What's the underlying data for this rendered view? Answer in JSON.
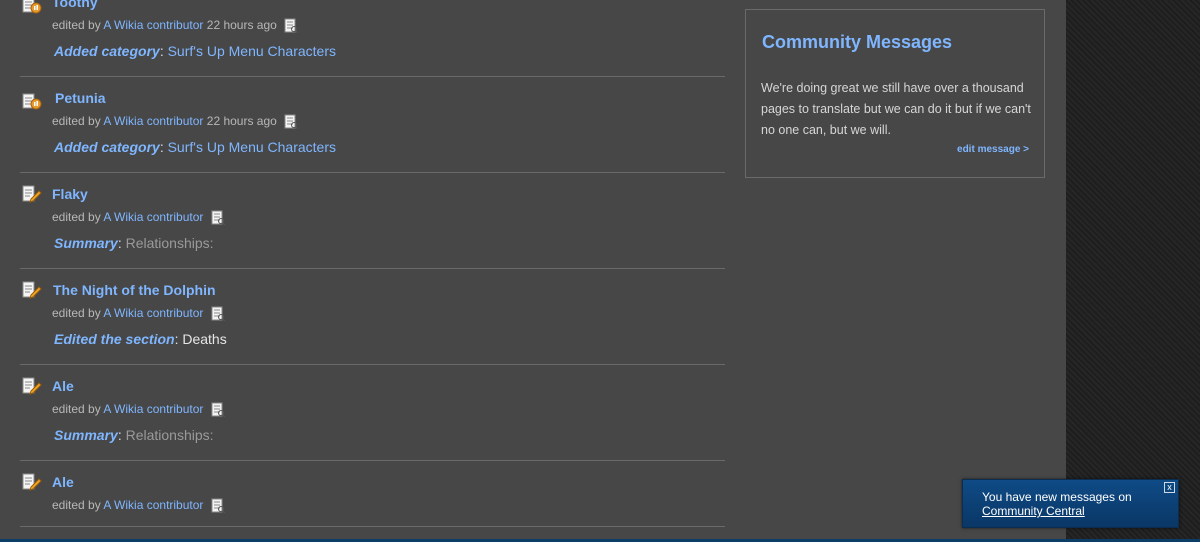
{
  "feed": {
    "entries": [
      {
        "type_icon": "category-change-icon",
        "title": "Toothy",
        "meta_prefix": "edited by",
        "user": "A Wikia contributor",
        "time": "22 hours ago",
        "detail_label": "Added category",
        "detail_value": "Surf's Up Menu Characters"
      },
      {
        "type_icon": "category-change-icon",
        "title": "Petunia",
        "meta_prefix": "edited by",
        "user": "A Wikia contributor",
        "time": "22 hours ago",
        "detail_label": "Added category",
        "detail_value": "Surf's Up Menu Characters"
      },
      {
        "type_icon": "edit-pencil-icon",
        "title": "Flaky",
        "meta_prefix": "edited by",
        "user": "A Wikia contributor",
        "time": "",
        "detail_label": "Summary",
        "detail_value": "Relationships:"
      },
      {
        "type_icon": "edit-pencil-icon",
        "title": "The Night of the Dolphin",
        "meta_prefix": "edited by",
        "user": "A Wikia contributor",
        "time": "",
        "detail_label": "Edited the section",
        "detail_value": "Deaths"
      },
      {
        "type_icon": "edit-pencil-icon",
        "title": "Ale",
        "meta_prefix": "edited by",
        "user": "A Wikia contributor",
        "time": "",
        "detail_label": "Summary",
        "detail_value": "Relationships:"
      },
      {
        "type_icon": "edit-pencil-icon",
        "title": "Ale",
        "meta_prefix": "edited by",
        "user": "A Wikia contributor",
        "time": "",
        "detail_label": "",
        "detail_value": ""
      }
    ]
  },
  "community": {
    "title": "Community Messages",
    "message": "We're doing great we still have over a thousand pages to translate but we can do it but if we can't no one can, but we will.",
    "edit_link": "edit message >"
  },
  "notification": {
    "text": "You have new messages on",
    "link": "Community Central",
    "close_label": "x"
  },
  "colors": {
    "link": "#7fb6ff",
    "page_bg": "#474747",
    "notification_bg": "#0f4b86"
  }
}
